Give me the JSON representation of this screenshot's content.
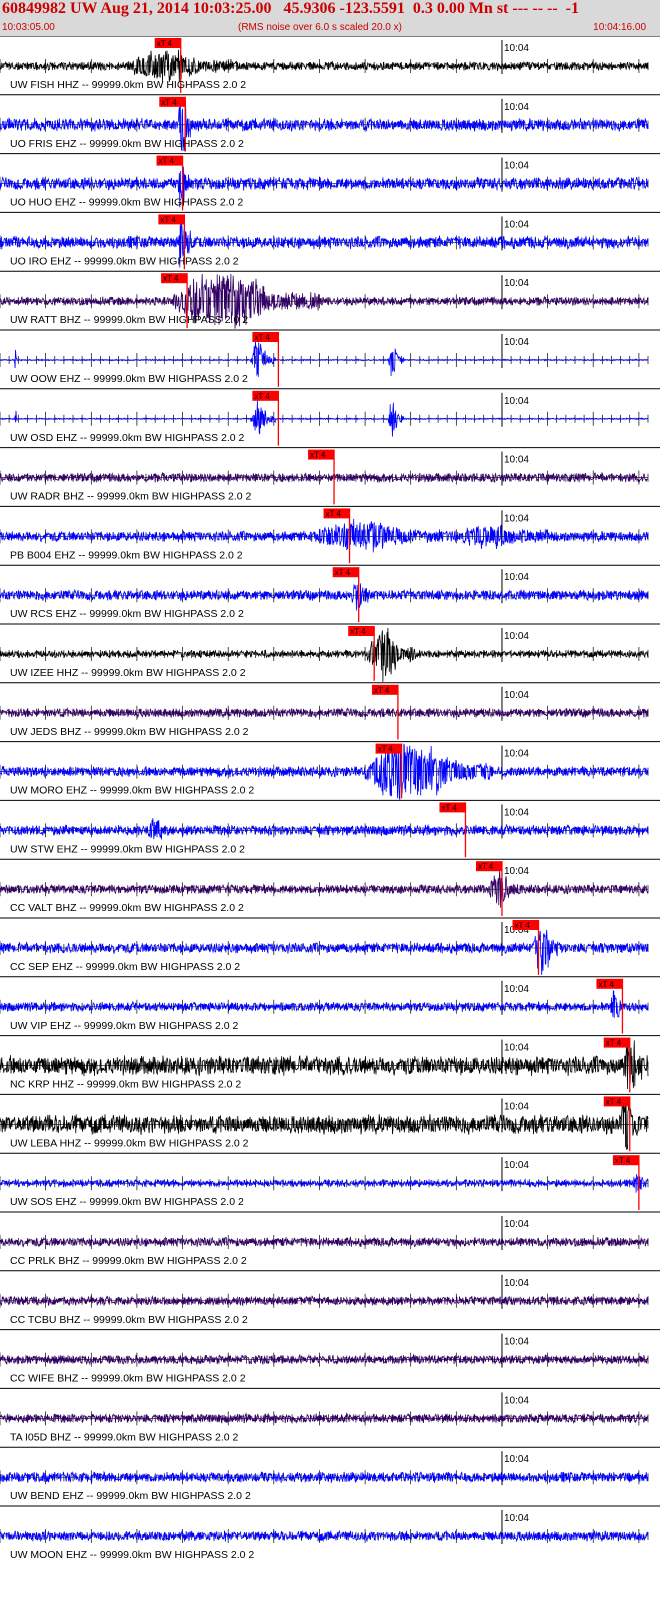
{
  "header": {
    "title": "60849982 UW Aug 21, 2014 10:03:25.00   45.9306 -123.5591  0.3 0.00 Mn st --- -- --  -1",
    "start_time": "10:03:05.00",
    "noise_note": "(RMS noise over 6.0 s scaled 20.0 x)",
    "end_time": "10:04:16.00"
  },
  "chart_data": {
    "type": "line",
    "title": "60849982 UW Aug 21, 2014 10:03:25.00   45.9306 -123.5591  0.3 0.00 Mn st --- -- --  -1",
    "x_unit": "seconds after 10:03:05.00",
    "x_range": [
      0,
      71
    ],
    "minute_tick_label": "10:04",
    "minute_tick_time": 55,
    "phase_label": "xT 4",
    "grid": false,
    "colors": {
      "black": "#000000",
      "blue": "#0000ff",
      "purple": "#330066",
      "pick": "#ff0000",
      "header_bg": "#d9d9d9",
      "header_text": "#cc0000"
    },
    "traces": [
      {
        "label": "UW FISH HHZ -- 99999.0km BW  HIGHPASS  2.0  2",
        "color": "black",
        "pick_time": 19.8,
        "noise": 0.12,
        "bursts": [
          [
            14,
            26,
            0.55
          ]
        ]
      },
      {
        "label": "UO FRIS EHZ -- 99999.0km BW  HIGHPASS  2.0  2",
        "color": "blue",
        "pick_time": 20.3,
        "noise": 0.18,
        "bursts": [
          [
            19.5,
            21.0,
            1.6
          ]
        ]
      },
      {
        "label": "UO HUO EHZ -- 99999.0km BW  HIGHPASS  2.0  2",
        "color": "blue",
        "pick_time": 20.0,
        "noise": 0.18,
        "bursts": [
          [
            19.5,
            20.8,
            1.3
          ]
        ]
      },
      {
        "label": "UO IRO EHZ -- 99999.0km BW  HIGHPASS  2.0  2",
        "color": "blue",
        "pick_time": 20.2,
        "noise": 0.18,
        "bursts": [
          [
            19.5,
            20.9,
            1.6
          ]
        ]
      },
      {
        "label": "UW RATT BHZ -- 99999.0km BW  HIGHPASS  2.0  2",
        "color": "purple",
        "pick_time": 20.5,
        "noise": 0.12,
        "bursts": [
          [
            19,
            35,
            1.2
          ]
        ]
      },
      {
        "label": "UW OOW EHZ -- 99999.0km BW  HIGHPASS  2.0  2",
        "color": "blue",
        "pick_time": 30.5,
        "noise": 0.02,
        "bursts": [
          [
            27.5,
            30.2,
            0.8
          ],
          [
            42.5,
            44.2,
            0.8
          ],
          [
            1.6,
            1.9,
            0.5
          ]
        ]
      },
      {
        "label": "UW OSD EHZ -- 99999.0km BW  HIGHPASS  2.0  2",
        "color": "blue",
        "pick_time": 30.5,
        "noise": 0.02,
        "bursts": [
          [
            27.5,
            30.2,
            0.8
          ],
          [
            42.5,
            44.2,
            0.8
          ],
          [
            1.6,
            1.9,
            0.5
          ]
        ]
      },
      {
        "label": "UW RADR BHZ -- 99999.0km BW  HIGHPASS  2.0  2",
        "color": "purple",
        "pick_time": 36.6,
        "noise": 0.13,
        "bursts": []
      },
      {
        "label": "PB B004 EHZ -- 99999.0km BW  HIGHPASS  2.0  2",
        "color": "blue",
        "pick_time": 38.3,
        "noise": 0.15,
        "bursts": [
          [
            34,
            50,
            0.45
          ],
          [
            50,
            60,
            0.35
          ]
        ]
      },
      {
        "label": "UW RCS EHZ -- 99999.0km BW  HIGHPASS  2.0  2",
        "color": "blue",
        "pick_time": 39.3,
        "noise": 0.15,
        "bursts": [
          [
            38.5,
            40.5,
            0.6
          ]
        ]
      },
      {
        "label": "UW IZEE HHZ -- 99999.0km BW  HIGHPASS  2.0  2",
        "color": "black",
        "pick_time": 41.0,
        "noise": 0.1,
        "bursts": [
          [
            40.2,
            45.5,
            1.1
          ]
        ]
      },
      {
        "label": "UW JEDS BHZ -- 99999.0km BW  HIGHPASS  2.0  2",
        "color": "purple",
        "pick_time": 43.6,
        "noise": 0.13,
        "bursts": []
      },
      {
        "label": "UW MORO EHZ -- 99999.0km BW  HIGHPASS  2.0  2",
        "color": "blue",
        "pick_time": 44.0,
        "noise": 0.15,
        "bursts": [
          [
            40,
            54,
            1.3
          ]
        ]
      },
      {
        "label": "UW STW EHZ -- 99999.0km BW  HIGHPASS  2.0  2",
        "color": "blue",
        "pick_time": 51.0,
        "noise": 0.15,
        "bursts": [
          [
            16,
            19,
            0.3
          ]
        ]
      },
      {
        "label": "CC VALT BHZ -- 99999.0km BW  HIGHPASS  2.0  2",
        "color": "purple",
        "pick_time": 55.0,
        "noise": 0.13,
        "bursts": [
          [
            53.5,
            57,
            0.6
          ]
        ]
      },
      {
        "label": "CC SEP EHZ -- 99999.0km BW  HIGHPASS  2.0  2",
        "color": "blue",
        "pick_time": 59.0,
        "noise": 0.15,
        "bursts": [
          [
            58.3,
            61.5,
            0.9
          ]
        ]
      },
      {
        "label": "UW VIP EHZ -- 99999.0km BW  HIGHPASS  2.0  2",
        "color": "blue",
        "pick_time": 68.2,
        "noise": 0.13,
        "bursts": [
          [
            66.8,
            68.5,
            0.6
          ]
        ]
      },
      {
        "label": "NC KRP HHZ -- 99999.0km BW  HIGHPASS  2.0  2",
        "color": "black",
        "pick_time": 69.0,
        "noise": 0.28,
        "bursts": [
          [
            68.3,
            70.5,
            1.1
          ]
        ]
      },
      {
        "label": "UW LEBA HHZ -- 99999.0km BW  HIGHPASS  2.0  2",
        "color": "black",
        "pick_time": 69.0,
        "noise": 0.28,
        "bursts": [
          [
            67.9,
            69.8,
            1.2
          ]
        ]
      },
      {
        "label": "UW SOS EHZ -- 99999.0km BW  HIGHPASS  2.0  2",
        "color": "blue",
        "pick_time": 70.0,
        "noise": 0.1,
        "bursts": [
          [
            69.3,
            71,
            0.4
          ]
        ]
      },
      {
        "label": "CC PRLK BHZ -- 99999.0km BW  HIGHPASS  2.0  2",
        "color": "purple",
        "pick_time": null,
        "noise": 0.13,
        "bursts": []
      },
      {
        "label": "CC TCBU BHZ -- 99999.0km BW  HIGHPASS  2.0  2",
        "color": "purple",
        "pick_time": null,
        "noise": 0.13,
        "bursts": []
      },
      {
        "label": "CC WIFE BHZ -- 99999.0km BW  HIGHPASS  2.0  2",
        "color": "purple",
        "pick_time": null,
        "noise": 0.13,
        "bursts": []
      },
      {
        "label": "TA I05D BHZ -- 99999.0km BW  HIGHPASS  2.0  2",
        "color": "purple",
        "pick_time": null,
        "noise": 0.13,
        "bursts": []
      },
      {
        "label": "UW BEND EHZ -- 99999.0km BW  HIGHPASS  2.0  2",
        "color": "blue",
        "pick_time": null,
        "noise": 0.15,
        "bursts": []
      },
      {
        "label": "UW MOON EHZ -- 99999.0km BW  HIGHPASS  2.0  2",
        "color": "blue",
        "pick_time": null,
        "noise": 0.15,
        "bursts": []
      }
    ]
  }
}
